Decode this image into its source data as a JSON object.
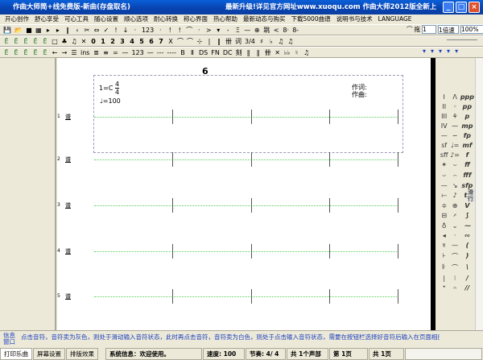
{
  "window": {
    "title": "作曲大师简+线免费版-新曲(存盘取名)",
    "promo": "最新升级!详见官方网址www.xuoqu.com 作曲大师2012版全新上",
    "minimize": "_",
    "maximize": "□",
    "close": "×"
  },
  "menu": [
    "开心创作",
    "舒心享受",
    "可心工具",
    "随心设置",
    "顺心选项",
    "耐心转换",
    "称心界面",
    "热心帮助",
    "最新动态与购买",
    "下载5000曲谱",
    "说明书与技术",
    "LANGUAGE"
  ],
  "toolbar1": [
    "💾",
    "📂",
    "■",
    "▦",
    "▸",
    "▸",
    "‖",
    "‹",
    "✂",
    "⇔",
    "✓",
    "!",
    "↓",
    "·",
    "123",
    "·",
    "!",
    "!",
    "⌒",
    "·",
    ">",
    "▾",
    "-",
    "Ξ",
    "—",
    "⊕",
    "跳",
    "<",
    "8·",
    "8-"
  ],
  "toolbar1_right": {
    "tie": "⌒",
    "drag_label": "拖",
    "drag_value": "1",
    "speed": "1倍速",
    "zoom": "100%"
  },
  "toolbar2": [
    "Ē",
    "Ē",
    "Ē",
    "Ē",
    "Ē",
    "□",
    "♣",
    "♫",
    "✕",
    "0",
    "1",
    "2",
    "3",
    "4",
    "5",
    "6",
    "7",
    "X",
    "⌒",
    "⌒",
    "⊹",
    "|",
    "‖",
    "卌",
    "词",
    "3/4",
    "♯",
    "♭",
    "♫",
    "♫"
  ],
  "toolbar3": [
    "Ē",
    "Ē",
    "Ē",
    "Ē",
    "Ē",
    "←",
    "→",
    "☰",
    "ins",
    "≣",
    "≡",
    "=",
    "—",
    "123",
    "—",
    "---",
    "----",
    "B",
    "Ⅱ",
    "DS",
    "FN",
    "DC",
    "刻",
    "‖",
    "‖",
    "卌",
    "✕",
    "♭♭",
    "♮",
    "♫"
  ],
  "toolbar3_right": [
    "▾",
    "▾",
    "▾",
    "▾",
    "▾"
  ],
  "score": {
    "page_number": "6",
    "key": "1=C",
    "time_top": "4",
    "time_bottom": "4",
    "tempo": "=100",
    "lyricist": "作词:",
    "composer": "作曲:",
    "staves": [
      "1",
      "2",
      "3",
      "4",
      "5"
    ],
    "staff_icon": "谱"
  },
  "palette": {
    "items": [
      "I",
      "Λ",
      "ppp",
      "II",
      "◦",
      "pp",
      "III",
      "⚘",
      "p",
      "IV",
      "⁓",
      "mp",
      "—",
      "∽",
      "fp",
      "sf",
      "♩=",
      "mf",
      "sff",
      "♪=",
      "f",
      "✶",
      "⌣",
      "ff",
      "⌣",
      "⌢",
      "fff",
      "—",
      "↘",
      "sfp",
      "⟝",
      "♪",
      "tr",
      "≑",
      "⊕",
      "V",
      "⊟",
      "𝄎",
      "⟆",
      "♁",
      "⌄",
      "⁓",
      "◂",
      "·",
      "∾",
      "𝄋",
      "—",
      "(",
      "⊦",
      "⌒",
      ")",
      "𝄆",
      "⌒",
      "\\",
      "|",
      "⁝",
      "/",
      "𝄌",
      "𝄐",
      "//"
    ],
    "tab_label": "滑行"
  },
  "info": {
    "label1": "信息",
    "label2": "窗口",
    "message": "点击音符，音符卖为灰色，则处于滑动输入音符状态，此时再点击音符，音符卖为白色，则处于点击输入音符状态，需要在按钮栏选择好音符后输入在页面相应位置。"
  },
  "status": {
    "tabs": [
      "打印乐曲",
      "屏幕设置",
      "排版效果"
    ],
    "system": "系统信息：欢迎使用。",
    "speed": "速度: 100",
    "meter": "节奏: 4/ 4",
    "voices": "共 1个声部",
    "page": "第 1页",
    "pages": "共 1页"
  }
}
